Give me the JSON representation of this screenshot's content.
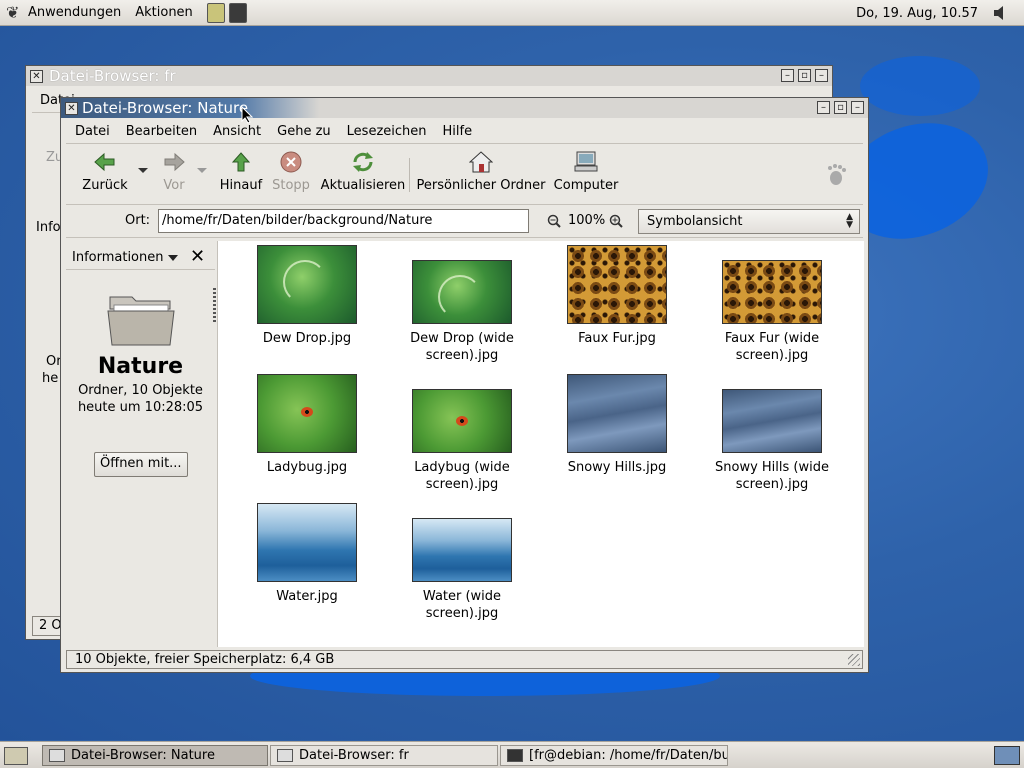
{
  "top_panel": {
    "menus": [
      "Anwendungen",
      "Aktionen"
    ],
    "clock": "Do, 19. Aug, 10.57"
  },
  "back_window": {
    "title": "Datei-Browser: fr",
    "menu_stub": "Datei",
    "side_stub_1": "Zu",
    "side_stub_2": "Info",
    "side_stub_3": "Or",
    "side_stub_4": "he",
    "status_stub": "2 O"
  },
  "window": {
    "title": "Datei-Browser: Nature",
    "menu": [
      "Datei",
      "Bearbeiten",
      "Ansicht",
      "Gehe zu",
      "Lesezeichen",
      "Hilfe"
    ],
    "toolbar": {
      "back": "Zurück",
      "forward": "Vor",
      "up": "Hinauf",
      "stop": "Stopp",
      "reload": "Aktualisieren",
      "home": "Persönlicher Ordner",
      "computer": "Computer"
    },
    "location": {
      "label": "Ort:",
      "path": "/home/fr/Daten/bilder/background/Nature",
      "zoom": "100%",
      "view": "Symbolansicht"
    },
    "sidebar": {
      "title": "Informationen",
      "close": "✕",
      "folder_name": "Nature",
      "info_line1": "Ordner, 10 Objekte",
      "info_line2": "heute um 10:28:05",
      "open_with": "Öffnen mit..."
    },
    "files": [
      {
        "name": "Dew Drop.jpg",
        "kind": "dew",
        "wide": false
      },
      {
        "name": "Dew Drop (wide screen).jpg",
        "kind": "dew",
        "wide": true
      },
      {
        "name": "Faux Fur.jpg",
        "kind": "fur",
        "wide": false
      },
      {
        "name": "Faux Fur (wide screen).jpg",
        "kind": "fur",
        "wide": true
      },
      {
        "name": "Ladybug.jpg",
        "kind": "lady",
        "wide": false
      },
      {
        "name": "Ladybug (wide screen).jpg",
        "kind": "lady",
        "wide": true
      },
      {
        "name": "Snowy Hills.jpg",
        "kind": "hills",
        "wide": false
      },
      {
        "name": "Snowy Hills (wide screen).jpg",
        "kind": "hills",
        "wide": true
      },
      {
        "name": "Water.jpg",
        "kind": "water",
        "wide": false
      },
      {
        "name": "Water (wide screen).jpg",
        "kind": "water",
        "wide": true
      }
    ],
    "status": "10 Objekte, freier Speicherplatz: 6,4 GB"
  },
  "taskbar": {
    "items": [
      {
        "label": "Datei-Browser: Nature",
        "active": true
      },
      {
        "label": "Datei-Browser: fr",
        "active": false
      },
      {
        "label": "[fr@debian: /home/fr/Daten/buc",
        "active": false
      }
    ]
  }
}
